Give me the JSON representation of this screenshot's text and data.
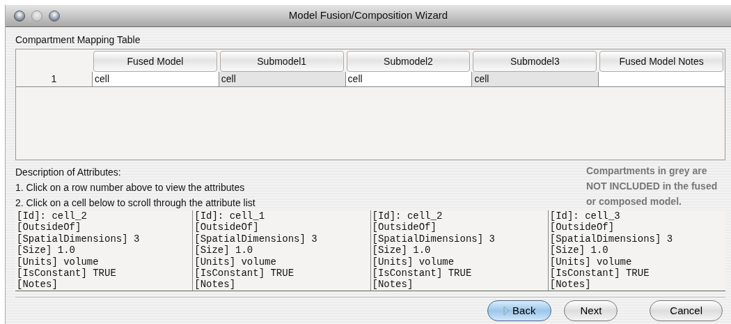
{
  "window": {
    "title": "Model Fusion/Composition Wizard",
    "buttons": [
      {
        "kind": "close",
        "disabled": false
      },
      {
        "kind": "minimize",
        "disabled": true
      },
      {
        "kind": "zoom",
        "disabled": false
      }
    ]
  },
  "mapping_table": {
    "title": "Compartment Mapping Table",
    "columns": [
      "Fused Model",
      "Submodel1",
      "Submodel2",
      "Submodel3",
      "Fused Model Notes"
    ],
    "rows": [
      {
        "number": "1",
        "cells": [
          {
            "text": "cell",
            "excluded": false
          },
          {
            "text": "cell",
            "excluded": true
          },
          {
            "text": "cell",
            "excluded": false
          },
          {
            "text": "cell",
            "excluded": true
          },
          {
            "excluded": false
          }
        ]
      }
    ]
  },
  "description": {
    "lines": [
      "Description of Attributes:",
      "1. Click on a row number above to view the attributes",
      "2. Click on a cell below to scroll through the attribute list"
    ],
    "note": "Compartments in grey are NOT INCLUDED in the fused or composed model."
  },
  "attribute_panels": [
    {
      "lines": [
        "[Id]: cell_2",
        "[OutsideOf]",
        "[SpatialDimensions] 3",
        "[Size] 1.0",
        "[Units] volume",
        "[IsConstant] TRUE",
        "[Notes]"
      ]
    },
    {
      "lines": [
        "[Id]: cell_1",
        "[OutsideOf]",
        "[SpatialDimensions] 3",
        "[Size] 1.0",
        "[Units] volume",
        "[IsConstant] TRUE",
        "[Notes]"
      ]
    },
    {
      "lines": [
        "[Id]: cell_2",
        "[OutsideOf]",
        "[SpatialDimensions] 3",
        "[Size] 1.0",
        "[Units] volume",
        "[IsConstant] TRUE",
        "[Notes]"
      ]
    },
    {
      "lines": [
        "[Id]: cell_3",
        "[OutsideOf]",
        "[SpatialDimensions] 3",
        "[Size] 1.0",
        "[Units] volume",
        "[IsConstant] TRUE",
        "[Notes]"
      ]
    }
  ],
  "buttons": [
    {
      "label": "Back",
      "default": true
    },
    {
      "label": "Next",
      "default": false
    },
    {
      "label": "Cancel",
      "default": false
    }
  ]
}
